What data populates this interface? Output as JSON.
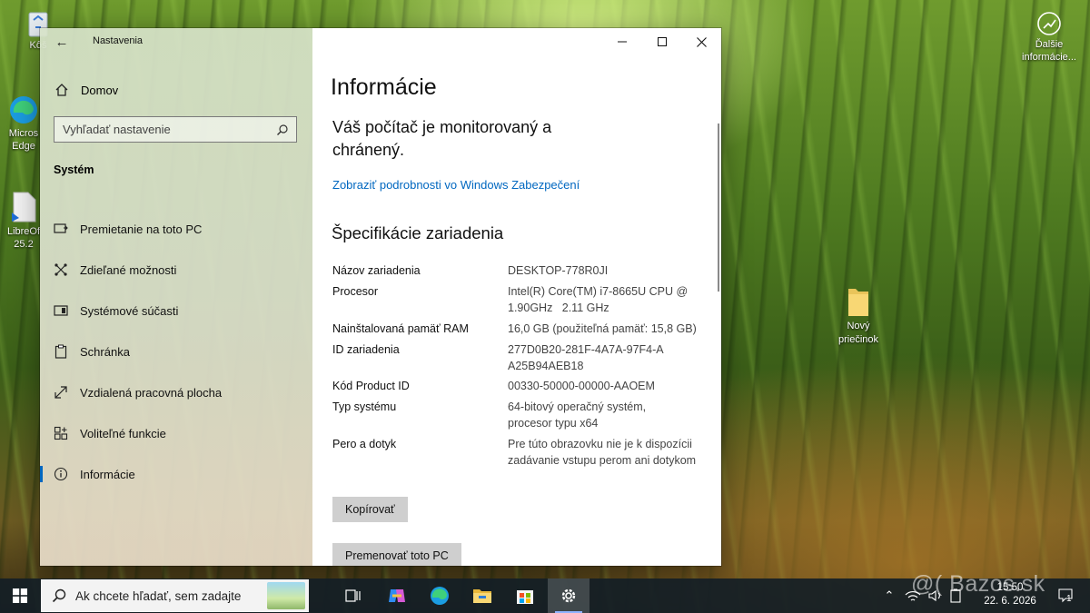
{
  "desktop": {
    "icons": [
      {
        "label": "Kôš"
      },
      {
        "label": "Micros\nEdge"
      },
      {
        "label": "LibreOf\n25.2"
      },
      {
        "label": "Nový\npriečinok"
      }
    ],
    "widget_label": "Ďalšie\ninformácie...",
    "watermark": "@( Bazos.sk"
  },
  "window": {
    "app_title": "Nastavenia",
    "sidebar": {
      "home_label": "Domov",
      "search_placeholder": "Vyhľadať nastavenie",
      "section_label": "Systém",
      "items": [
        {
          "label": "Premietanie na toto PC",
          "icon": "projection-icon"
        },
        {
          "label": "Zdieľané možnosti",
          "icon": "share-icon"
        },
        {
          "label": "Systémové súčasti",
          "icon": "components-icon"
        },
        {
          "label": "Schránka",
          "icon": "clipboard-icon"
        },
        {
          "label": "Vzdialená pracovná plocha",
          "icon": "remote-desktop-icon"
        },
        {
          "label": "Voliteľné funkcie",
          "icon": "optional-features-icon"
        },
        {
          "label": "Informácie",
          "icon": "info-icon",
          "active": true
        }
      ]
    },
    "content": {
      "title": "Informácie",
      "status": "Váš počítač je monitorovaný a chránený.",
      "security_link": "Zobraziť podrobnosti vo Windows Zabezpečení",
      "spec_title": "Špecifikácie zariadenia",
      "specs": [
        {
          "key": "Názov zariadenia",
          "value": "DESKTOP-778R0JI"
        },
        {
          "key": "Procesor",
          "value": "Intel(R) Core(TM) i7-8665U CPU @ 1.90GHz   2.11 GHz"
        },
        {
          "key": "Nainštalovaná pamäť RAM",
          "value": "16,0 GB (použiteľná pamäť: 15,8 GB)"
        },
        {
          "key": "ID zariadenia",
          "value": "277D0B20-281F-4A7A-97F4-AA25B94AEB18"
        },
        {
          "key": "Kód Product ID",
          "value": "00330-50000-00000-AAOEM"
        },
        {
          "key": "Typ systému",
          "value": "64-bitový operačný systém, procesor typu x64"
        },
        {
          "key": "Pero a dotyk",
          "value": "Pre túto obrazovku nie je k dispozícii zadávanie vstupu perom ani dotykom"
        }
      ],
      "copy_button": "Kopírovať",
      "rename_button": "Premenovať toto PC"
    }
  },
  "taskbar": {
    "search_placeholder": "Ak chcete hľadať, sem zadajte",
    "apps": [
      "task-view-icon",
      "copilot-icon",
      "edge-icon",
      "file-explorer-icon",
      "store-icon",
      "settings-icon"
    ],
    "clock": {
      "time": "15:50",
      "date": "22. 6. 2026"
    },
    "notification_count": "1"
  },
  "colors": {
    "accent": "#0067c0",
    "link": "#0067c0",
    "taskbar": "#141e26"
  }
}
